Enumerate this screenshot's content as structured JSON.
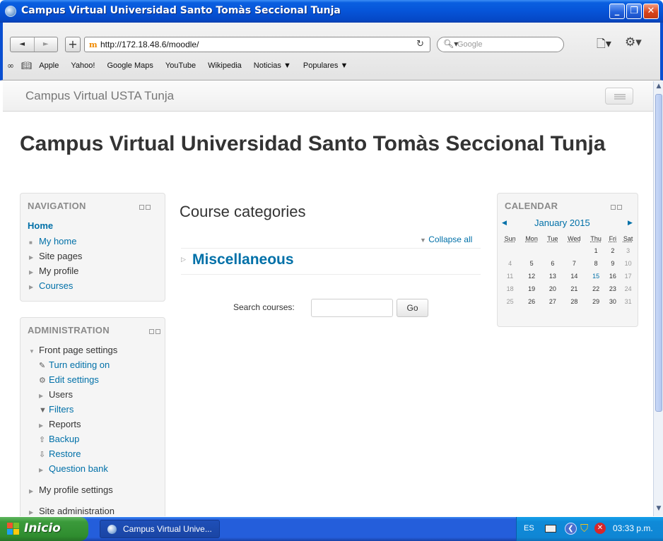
{
  "window": {
    "title": "Campus Virtual Universidad Santo Tomàs Seccional Tunja",
    "min_icon": "minimize-icon",
    "max_icon": "maximize-icon",
    "close_icon": "close-icon"
  },
  "browser": {
    "back": "◄",
    "forward": "►",
    "new_tab": "+",
    "url": "http://172.18.48.6/moodle/",
    "reload": "↻",
    "search_placeholder": "Google",
    "bookmarks": [
      "Apple",
      "Yahoo!",
      "Google Maps",
      "YouTube",
      "Wikipedia",
      "Noticias ▼",
      "Populares ▼"
    ]
  },
  "site": {
    "brand": "Campus Virtual USTA Tunja",
    "title": "Campus Virtual Universidad Santo Tomàs Seccional Tunja"
  },
  "navigation": {
    "header": "NAVIGATION",
    "home": "Home",
    "items": [
      {
        "label": "My home",
        "marker": "■",
        "link": true
      },
      {
        "label": "Site pages",
        "marker": "▶",
        "link": false
      },
      {
        "label": "My profile",
        "marker": "▶",
        "link": false
      },
      {
        "label": "Courses",
        "marker": "▶",
        "link": true
      }
    ]
  },
  "administration": {
    "header": "ADMINISTRATION",
    "front_page_settings": "Front page settings",
    "items": [
      {
        "label": "Turn editing on",
        "icon": "pencil-icon",
        "link": true
      },
      {
        "label": "Edit settings",
        "icon": "gear-icon",
        "link": true
      },
      {
        "label": "Users",
        "icon": "expand-arrow-icon",
        "link": false
      },
      {
        "label": "Filters",
        "icon": "filter-icon",
        "link": true
      },
      {
        "label": "Reports",
        "icon": "expand-arrow-icon",
        "link": false
      },
      {
        "label": "Backup",
        "icon": "backup-icon",
        "link": true
      },
      {
        "label": "Restore",
        "icon": "restore-icon",
        "link": true
      },
      {
        "label": "Question bank",
        "icon": "expand-arrow-icon",
        "link": true
      }
    ],
    "my_profile_settings": "My profile settings",
    "site_administration": "Site administration"
  },
  "main": {
    "title": "Course categories",
    "collapse_all": "Collapse all",
    "category": "Miscellaneous",
    "search_label": "Search courses:",
    "search_value": "",
    "go": "Go"
  },
  "calendar": {
    "header": "CALENDAR",
    "month": "January 2015",
    "weekdays": [
      "Sun",
      "Mon",
      "Tue",
      "Wed",
      "Thu",
      "Fri",
      "Sat"
    ],
    "weeks": [
      [
        "",
        "",
        "",
        "",
        "1",
        "2",
        "3"
      ],
      [
        "4",
        "5",
        "6",
        "7",
        "8",
        "9",
        "10"
      ],
      [
        "11",
        "12",
        "13",
        "14",
        "15",
        "16",
        "17"
      ],
      [
        "18",
        "19",
        "20",
        "21",
        "22",
        "23",
        "24"
      ],
      [
        "25",
        "26",
        "27",
        "28",
        "29",
        "30",
        "31"
      ]
    ],
    "today": "15"
  },
  "taskbar": {
    "start": "Inicio",
    "task": "Campus Virtual Unive...",
    "lang": "ES",
    "clock": "03:33 p.m."
  }
}
